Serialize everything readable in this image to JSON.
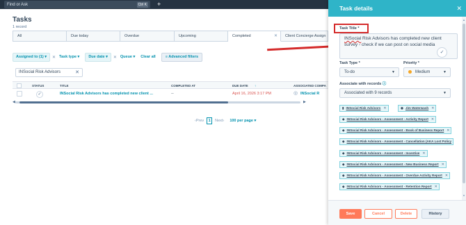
{
  "topbar": {
    "search_placeholder": "Find or Ask",
    "shortcut": "Ctrl K",
    "plus": "+"
  },
  "page": {
    "title": "Tasks",
    "count": "1 record"
  },
  "tabs": [
    {
      "label": "All"
    },
    {
      "label": "Due today"
    },
    {
      "label": "Overdue"
    },
    {
      "label": "Upcoming"
    },
    {
      "label": "Completed"
    },
    {
      "label": "Client Concierge Assign"
    }
  ],
  "filters": {
    "assigned": "Assigned to (1) ▾",
    "task_type": "Task type ▾",
    "due_date": "Due date ▾",
    "queue": "Queue ▾",
    "clear_all": "Clear all",
    "advanced": "Advanced filters"
  },
  "search": {
    "value": "INSocial Risk Advisors"
  },
  "table": {
    "columns": [
      "STATUS",
      "TITLE",
      "COMPLETED AT",
      "DUE DATE",
      "ASSOCIATED COMPA"
    ],
    "rows": [
      {
        "title": "INSocial Risk Advisors has completed new client ...",
        "completed_at": "--",
        "due_date": "April 16, 2026 3:17 PM",
        "company": "INSocial R"
      }
    ]
  },
  "pager": {
    "prev": "Prev",
    "page": "1",
    "next": "Next",
    "per_page": "100 per page ▾"
  },
  "panel": {
    "header": "Task details",
    "title_label": "Task Title *",
    "title_underlined": "INSocial",
    "title_rest": " Risk Advisors has completed new client survey - check if we can post on social media",
    "task_type_label": "Task Type *",
    "task_type_value": "To-do",
    "priority_label": "Priority *",
    "priority_value": "Medium",
    "assoc_label": "Associate with records",
    "assoc_value": "Associated with 9 records",
    "records": [
      {
        "label": "INSocial Risk Advisors"
      },
      {
        "label": "Jim Waterwash"
      },
      {
        "label": "INSocial Risk Advisors - Assessment - Activity Report"
      },
      {
        "label": "INSocial Risk Advisors - Assessment - Book of Business Report"
      },
      {
        "label": "INSocial Risk Advisors - Assessment - Cancellation (AKA Lost Policy"
      },
      {
        "label": "INSocial Risk Advisors - Assessment - Incentive"
      },
      {
        "label": "INSocial Risk Advisors - Assessment - New Business Report"
      },
      {
        "label": "INSocial Risk Advisors - Assessment - Overdue Activity Report"
      },
      {
        "label": "INSocial Risk Advisors - Assessment - Retention Report"
      }
    ],
    "buttons": {
      "save": "Save",
      "cancel": "Cancel",
      "delete": "Delete",
      "history": "History"
    }
  },
  "colors": {
    "accent": "#0091ae",
    "header": "#2fb4c8",
    "topbar": "#253342",
    "annotation": "#d42a2a",
    "save": "#ff7a59"
  }
}
